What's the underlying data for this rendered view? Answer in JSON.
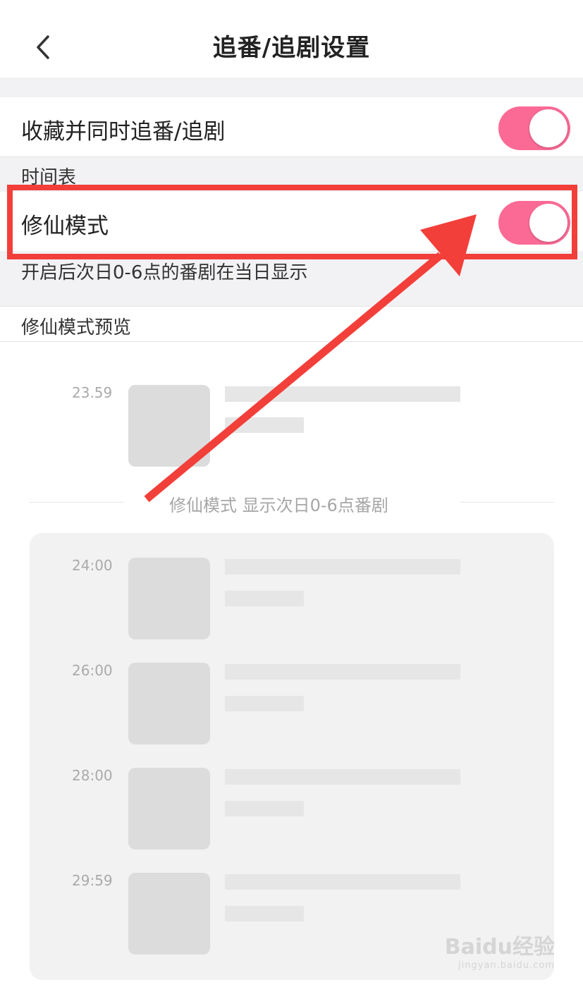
{
  "header": {
    "title": "追番/追剧设置"
  },
  "settings": {
    "follow_toggle_label": "收藏并同时追番/追剧",
    "follow_toggle_on": true,
    "schedule_section_title": "时间表",
    "xiuxian_toggle_label": "修仙模式",
    "xiuxian_toggle_on": true,
    "xiuxian_description": "开启后次日0-6点的番剧在当日显示",
    "preview_section_title": "修仙模式预览"
  },
  "preview": {
    "before_item": {
      "time": "23.59"
    },
    "separator_text": "修仙模式 显示次日0-6点番剧",
    "items": [
      {
        "time": "24:00"
      },
      {
        "time": "26:00"
      },
      {
        "time": "28:00"
      },
      {
        "time": "29:59"
      }
    ]
  },
  "watermark": {
    "brand": "Baidu经验",
    "url": "jingyan.baidu.com"
  },
  "colors": {
    "toggle_on": "#fb6a95",
    "annotation": "#f23f3a",
    "section_bg": "#f2f2f4"
  }
}
